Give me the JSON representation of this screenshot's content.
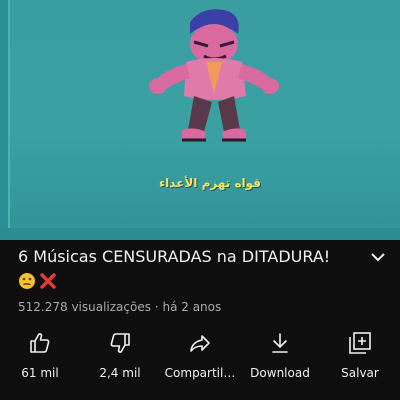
{
  "video": {
    "caption_text": "قواه تهزم الأعداء",
    "title": "6 Músicas CENSURADAS na DITADURA!",
    "emojis": [
      "confused-face-icon",
      "cross-mark-icon"
    ],
    "views": "512.278 visualizações",
    "separator": "·",
    "age": "há 2 anos"
  },
  "actions": [
    {
      "name": "like",
      "label": "61 mil",
      "icon": "thumbs-up-icon"
    },
    {
      "name": "dislike",
      "label": "2,4 mil",
      "icon": "thumbs-down-icon"
    },
    {
      "name": "share",
      "label": "Compartil…",
      "icon": "share-icon"
    },
    {
      "name": "download",
      "label": "Download",
      "icon": "download-icon"
    },
    {
      "name": "save",
      "label": "Salvar",
      "icon": "save-to-playlist-icon"
    }
  ],
  "colors": {
    "background": "#0f0f0f",
    "player_teal": "#3a9ea1",
    "caption_yellow": "#f2e36a",
    "secondary_text": "#aaaaaa"
  }
}
